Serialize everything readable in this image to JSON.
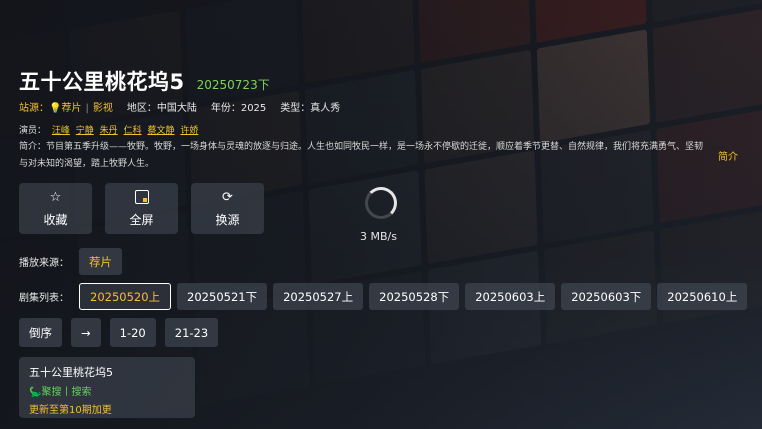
{
  "show": {
    "title": "五十公里桃花坞5",
    "episode": "20250723下"
  },
  "meta": {
    "site_label": "站源：",
    "site_name": "荐片",
    "site_sep": "|",
    "site_type": "影视",
    "region": "地区：中国大陆",
    "year": "年份：2025",
    "genre": "类型：真人秀"
  },
  "cast": {
    "label": "演员：",
    "names": [
      "汪峰",
      "宁静",
      "朱丹",
      "仁科",
      "蔡文静",
      "许娇"
    ]
  },
  "description": "简介：节目第五季升级——牧野。牧野，一场身体与灵魂的放逐与归途。人生也如同牧民一样，是一场永不停歇的迁徙，顺应着季节更替、自然规律，我们将充满勇气、坚韧与对未知的渴望，踏上牧野人生。",
  "intro_link": "简介",
  "actions": [
    {
      "label": "收藏",
      "icon": "star-icon"
    },
    {
      "label": "全屏",
      "icon": "fullscreen-icon"
    },
    {
      "label": "换源",
      "icon": "refresh-icon"
    }
  ],
  "player": {
    "speed": "3 MB/s"
  },
  "source": {
    "label": "播放来源：",
    "current": "荐片"
  },
  "episodes": {
    "label": "剧集列表：",
    "items": [
      "20250520上",
      "20250521下",
      "20250527上",
      "20250528下",
      "20250603上",
      "20250603下",
      "20250610上"
    ],
    "selected_index": 0
  },
  "controls": {
    "reverse": "倒序",
    "arrow": "→",
    "ranges": [
      "1-20",
      "21-23"
    ]
  },
  "card": {
    "title": "五十公里桃花坞5",
    "links": "🦕聚搜丨搜索",
    "update": "更新至第10期加更"
  },
  "colors": {
    "accent": "#f2c12e",
    "episode_green": "#7fd35a",
    "link_green": "#5fd35a",
    "chip_bg": "#464c58"
  }
}
